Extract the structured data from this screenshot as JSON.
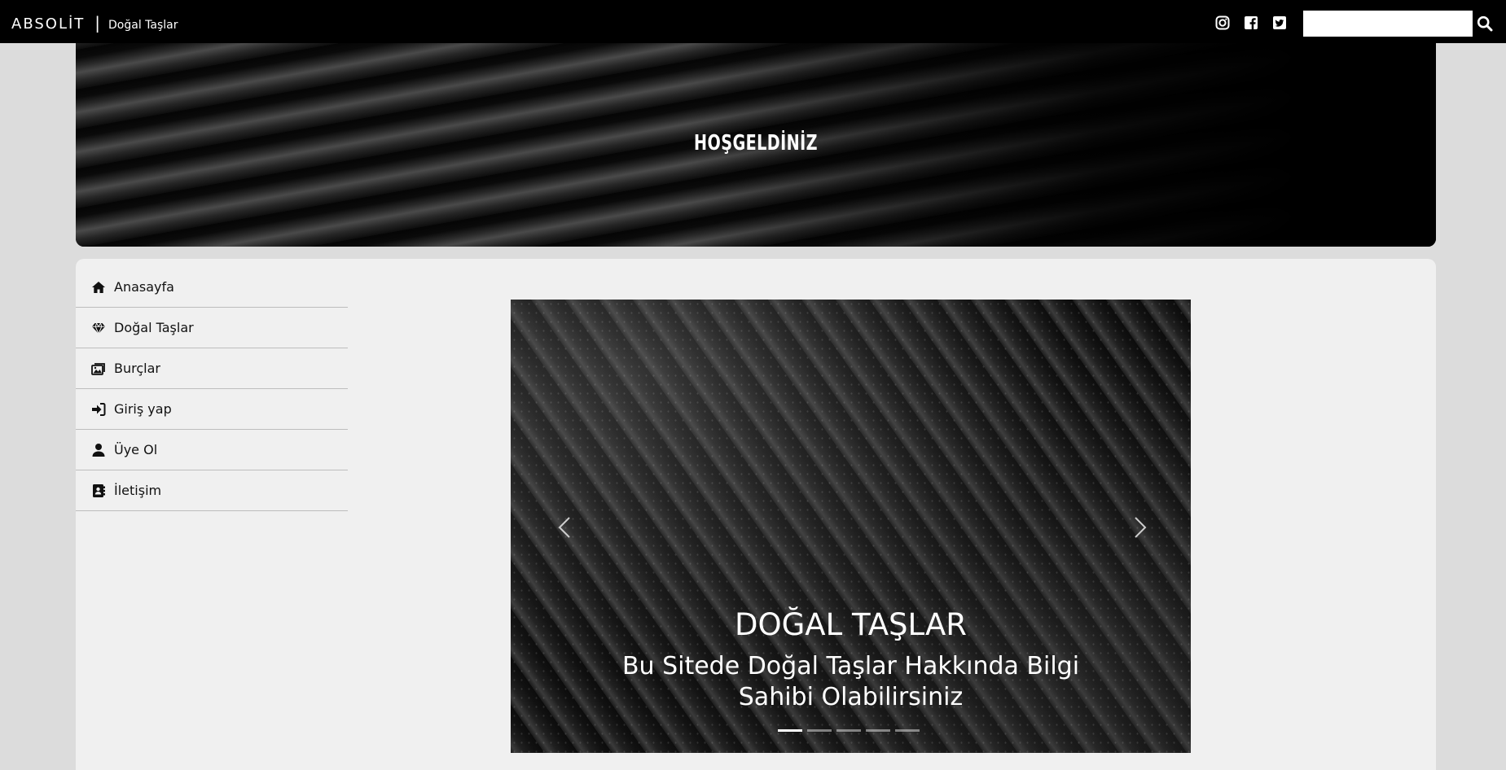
{
  "navbar": {
    "brand": "ABSOLİT",
    "separator": "|",
    "subtitle": "Doğal Taşlar",
    "social_icons": [
      "instagram-icon",
      "facebook-icon",
      "twitter-icon"
    ],
    "search": {
      "value": "",
      "placeholder": ""
    }
  },
  "hero": {
    "title": "HOŞGELDİNİZ"
  },
  "sidebar": {
    "items": [
      {
        "label": "Anasayfa",
        "icon": "home-icon"
      },
      {
        "label": "Doğal Taşlar",
        "icon": "gem-icon"
      },
      {
        "label": "Burçlar",
        "icon": "images-icon"
      },
      {
        "label": "Giriş yap",
        "icon": "sign-in-icon"
      },
      {
        "label": "Üye Ol",
        "icon": "user-icon"
      },
      {
        "label": "İletişim",
        "icon": "address-book-icon"
      }
    ]
  },
  "carousel": {
    "caption_title": "DOĞAL TAŞLAR",
    "caption_text_line1": "Bu Sitede Doğal Taşlar Hakkında Bilgi",
    "caption_text_line2": "Sahibi Olabilirsiniz",
    "slide_count": 5,
    "active_slide": 1
  },
  "colors": {
    "navbar_bg": "#000000",
    "page_bg": "#dcdcdc",
    "panel_bg": "#f0f0f0"
  }
}
